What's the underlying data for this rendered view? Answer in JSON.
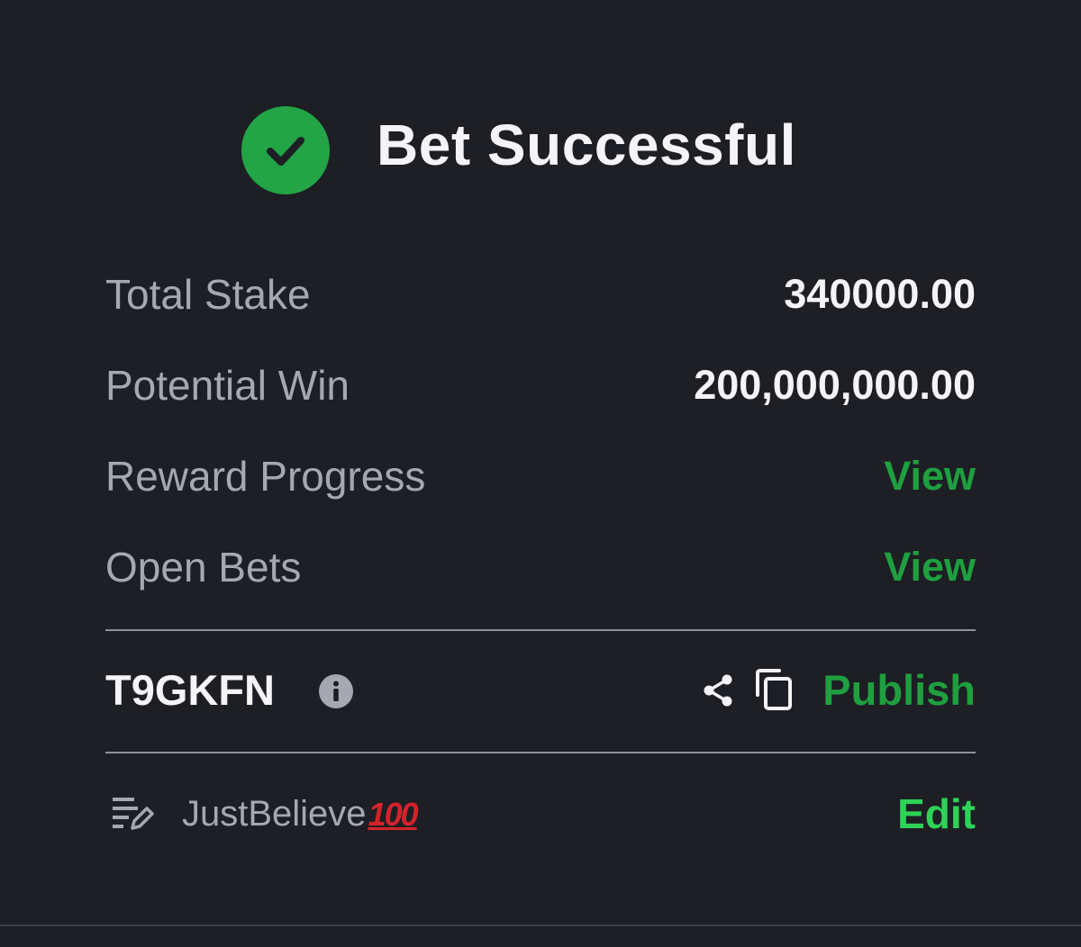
{
  "header": {
    "title": "Bet Successful",
    "icon": "check-circle-icon"
  },
  "details": {
    "total_stake_label": "Total Stake",
    "total_stake_value": "340000.00",
    "potential_win_label": "Potential Win",
    "potential_win_value": "200,000,000.00",
    "reward_progress_label": "Reward Progress",
    "reward_progress_link": "View",
    "open_bets_label": "Open Bets",
    "open_bets_link": "View"
  },
  "booking": {
    "code": "T9GKFN",
    "info_icon": "info-icon",
    "share_icon": "share-icon",
    "copy_icon": "copy-icon",
    "publish_label": "Publish"
  },
  "note": {
    "icon": "note-edit-icon",
    "text": "JustBelieve",
    "badge": "100",
    "edit_label": "Edit"
  },
  "colors": {
    "background": "#1d1f25",
    "success_green": "#22a447",
    "link_green": "#1f9f3f",
    "edit_green": "#2ed257",
    "label_gray": "#a5a8b1",
    "value_white": "#f4f4f6",
    "badge_red": "#d4232a"
  }
}
